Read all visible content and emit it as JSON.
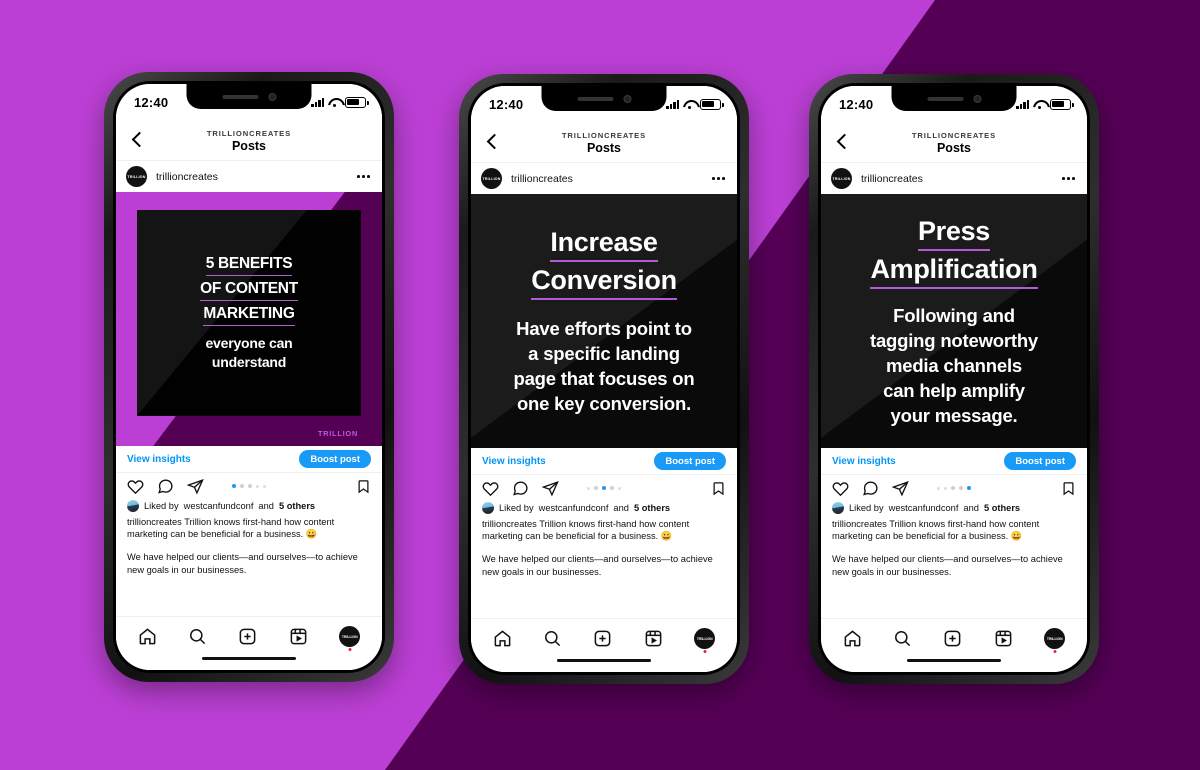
{
  "background": {
    "light_purple": "#bb3fd4",
    "dark_purple": "#540055"
  },
  "brand": {
    "accent_purple": "#b45bd4",
    "instagram_blue": "#0095f6",
    "watermark": "TRILLION",
    "avatar_label": "TRILLION"
  },
  "status_bar": {
    "time": "12:40"
  },
  "nav": {
    "kicker": "TRILLIONCREATES",
    "title": "Posts"
  },
  "post_header": {
    "username": "trillioncreates"
  },
  "insights": {
    "view_label": "View insights",
    "boost_label": "Boost post"
  },
  "social": {
    "liked_prefix": "Liked by",
    "liked_user": "westcanfundconf",
    "liked_and": "and",
    "liked_others": "5 others",
    "caption_user": "trillioncreates",
    "caption_line1": "Trillion knows first-hand how content marketing can be beneficial for a business. 😀",
    "caption_line2": "We have helped our clients—and ourselves—to achieve new goals in our businesses."
  },
  "phones": [
    {
      "id": "phone-1",
      "slide_index": 0,
      "total_slides": 5,
      "post": {
        "style": "framed",
        "headline_lines": [
          "5 BENEFITS",
          "OF CONTENT",
          "MARKETING"
        ],
        "sub_lines": [
          "everyone can",
          "understand"
        ],
        "watermark": "TRILLION"
      }
    },
    {
      "id": "phone-2",
      "slide_index": 2,
      "total_slides": 5,
      "post": {
        "style": "full",
        "headline_lines": [
          "Increase",
          "Conversion"
        ],
        "sub_lines": [
          "Have efforts point to",
          "a specific landing",
          "page that focuses on",
          "one key conversion."
        ]
      }
    },
    {
      "id": "phone-3",
      "slide_index": 4,
      "total_slides": 5,
      "post": {
        "style": "full",
        "headline_lines": [
          "Press",
          "Amplification"
        ],
        "sub_lines": [
          "Following and",
          "tagging noteworthy",
          "media channels",
          "can help amplify",
          "your message."
        ]
      }
    }
  ],
  "tabbar": {
    "items": [
      "home-icon",
      "search-icon",
      "add-post-icon",
      "reels-icon",
      "profile-avatar"
    ]
  }
}
